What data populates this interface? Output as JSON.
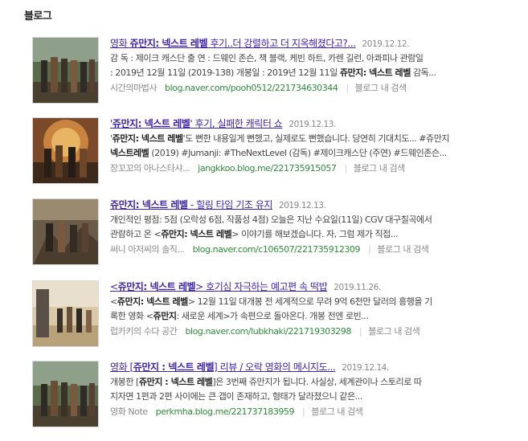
{
  "section": {
    "title": "블로그"
  },
  "results": [
    {
      "title_pre": "영화 ",
      "title_bold": "쥬만지: 넥스트 레벨",
      "title_post": " 후기..더 강렬하고 더 지옥해졌다고?...",
      "date": "2019.12.12.",
      "line2_a": "감 독 : 제이크 캐스단 출 연 : 드웨인 존슨, 잭 블랙, 케빈 하트, 카렌 길런, 아콰피나 관람일",
      "line2_b": "",
      "line2_c": "",
      "line3_a": ": 2019년 12월 11일 (2019-138) 개봉일 : 2019년 12월 11일 ",
      "line3_b": "쥬만지: 넥스트 레벨",
      "line3_c": " 감독...",
      "blog_name": "시간의마법사",
      "url": "blog.naver.com/pooh0512/221734630344",
      "search_in": "블로그 내 검색"
    },
    {
      "title_pre": "'",
      "title_bold": "쥬만지: 넥스트 레벨",
      "title_post": "' 후기, 실패한 캐릭터 쇼",
      "date": "2019.12.13.",
      "line2_a": "'",
      "line2_b": "쥬만지: 넥스트 레벨",
      "line2_c": "'도 뻔한 내용일게 뻔했고, 실제로도 뻔했습니다. 당연히 기대치도... #쥬만지",
      "line3_a": "",
      "line3_b": "넥스트레벨",
      "line3_c": " (2019) #Jumanji: #TheNextLevel (감독) #제이크캐스단 (주연) #드웨인존슨...",
      "blog_name": "장꼬꼬의 아나스타샤...",
      "url": "jangkkoo.blog.me/221735915057",
      "search_in": "블로그 내 검색"
    },
    {
      "title_pre": "",
      "title_bold": "쥬만지: 넥스트 레벨",
      "title_post": " - 힐링 타임 기조 유지",
      "date": "2019.12.13.",
      "line2_a": "개인적인 평점: 5점 (오락성 6점, 작품성 4점) 오늘은 지난 수요일(11일) CGV 대구칠곡에서",
      "line2_b": "",
      "line2_c": "",
      "line3_a": "관람하고 온 <",
      "line3_b": "쥬만지: 넥스트 레벨",
      "line3_c": "> 이야기를 해보겠습니다. 자, 그럼 제가 직접...",
      "blog_name": "써니 아저씨의 솔직...",
      "url": "blog.naver.com/c106507/221735912309",
      "search_in": "블로그 내 검색"
    },
    {
      "title_pre": "<",
      "title_bold": "쥬만지: 넥스트 레벨",
      "title_post": "> 호기심 자극하는 예고편 속 떡밥",
      "date": "2019.11.26.",
      "line2_a": "<",
      "line2_b": "쥬만지: 넥스트 레벨",
      "line2_c": "> 12월 11일 대개봉 전 세계적으로 무려 9억 6천만 달러의 흥행을 기",
      "line3_a": "록한 영화 <",
      "line3_b": "쥬만지",
      "line3_c": ": 새로운 세계>가 속편으로 돌아온다. 개봉 전엔 로빈...",
      "blog_name": "럽카키의 수다 공간",
      "url": "blog.naver.com/lubkhaki/221719303298",
      "search_in": "블로그 내 검색"
    },
    {
      "title_pre": "영화 [",
      "title_bold": "쥬만지 : 넥스트 레벨",
      "title_post": "] 리뷰 / 오락 영화의 메시지도...",
      "date": "2019.12.14.",
      "line2_a": "개봉한 [",
      "line2_b": "쥬만지 : 넥스트 레벨",
      "line2_c": "]은 3번째 쥬만지가 됩니다. 사실상, 세계관이나 스토리로 따",
      "line3_a": "지자면 1편과 2편 사이에는 큰 갭이 존재하고, 형태가 달라졌으니 같은...",
      "line3_b": "",
      "line3_c": "",
      "blog_name": "영화 Note",
      "url": "perkmha.blog.me/221737183959",
      "search_in": "블로그 내 검색"
    }
  ]
}
